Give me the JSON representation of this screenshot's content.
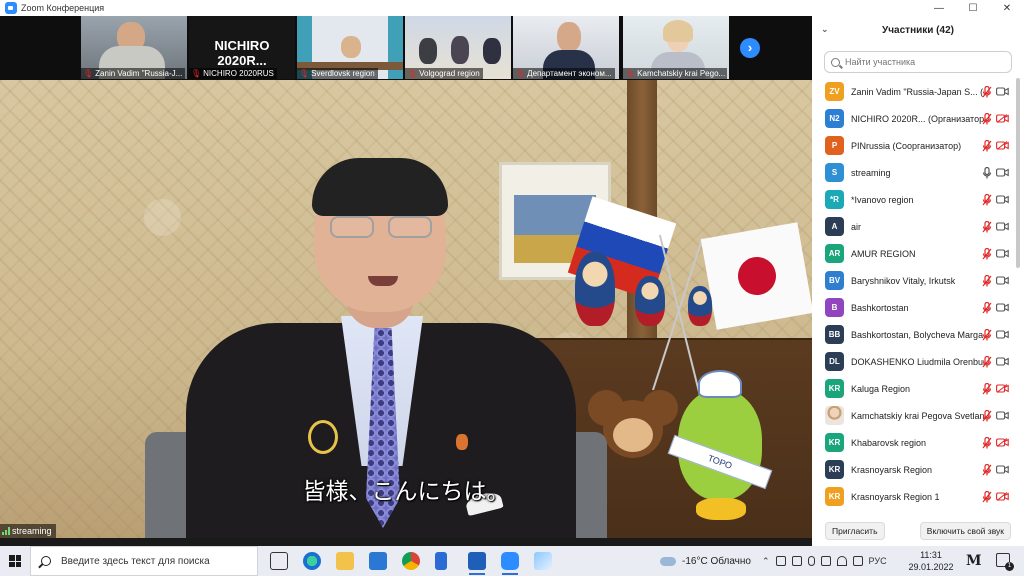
{
  "window": {
    "title": "Zoom Конференция",
    "controls": {
      "minimize": "—",
      "maximize": "☐",
      "close": "✕"
    }
  },
  "thumbnails": [
    {
      "label": "Zanin Vadim \"Russia-J...",
      "muted": true,
      "has_video": true
    },
    {
      "label": "NICHIRO 2020RUS",
      "name_overlay": "NICHIRO 2020R...",
      "muted": true,
      "has_video": false
    },
    {
      "label": "Sverdlovsk region",
      "muted": true,
      "has_video": true
    },
    {
      "label": "Volgograd region",
      "muted": true,
      "has_video": true
    },
    {
      "label": "Департамент эконом...",
      "muted": true,
      "has_video": true
    },
    {
      "label": "Kamchatskiy krai Pego...",
      "muted": true,
      "has_video": true
    }
  ],
  "next_page_icon": "chevron-right-icon",
  "main_video": {
    "speaker": "streaming",
    "subtitle": "皆様、こんにちは。",
    "sash_text": "ТОРО"
  },
  "participants_panel": {
    "title": "Участники (42)",
    "search_placeholder": "Найти участника",
    "participants": [
      {
        "initials": "ZV",
        "color": "#f0a020",
        "name": "Zanin Vadim \"Russia-Japan S... (Я)",
        "mic": "muted",
        "cam": "on"
      },
      {
        "initials": "N2",
        "color": "#2d7fd3",
        "name": "NICHIRO 2020R... (Организатор)",
        "mic": "muted",
        "cam": "off"
      },
      {
        "initials": "P",
        "color": "#e0621e",
        "name": "PINrussia (Соорганизатор)",
        "mic": "muted",
        "cam": "off"
      },
      {
        "initials": "S",
        "color": "#2f8fd3",
        "name": "streaming",
        "mic": "on",
        "cam": "on"
      },
      {
        "initials": "*R",
        "color": "#1aa9b5",
        "name": "*Ivanovo region",
        "mic": "muted",
        "cam": "on"
      },
      {
        "initials": "A",
        "color": "#2c3e55",
        "name": "air",
        "mic": "muted",
        "cam": "on"
      },
      {
        "initials": "AR",
        "color": "#1aa57a",
        "name": "AMUR REGION",
        "mic": "muted",
        "cam": "on"
      },
      {
        "initials": "BV",
        "color": "#2f7fd0",
        "name": "Baryshnikov Vitaly, Irkutsk",
        "mic": "muted",
        "cam": "on"
      },
      {
        "initials": "B",
        "color": "#9146c0",
        "name": "Bashkortostan",
        "mic": "muted",
        "cam": "on"
      },
      {
        "initials": "BB",
        "color": "#2c3e55",
        "name": "Bashkortostan, Bolycheva Marga...",
        "mic": "muted",
        "cam": "on"
      },
      {
        "initials": "DL",
        "color": "#2c3e55",
        "name": "DOKASHENKO Liudmila Orenburg",
        "mic": "muted",
        "cam": "on"
      },
      {
        "initials": "KR",
        "color": "#1aa57a",
        "name": "Kaluga Region",
        "mic": "muted",
        "cam": "off"
      },
      {
        "initials": "",
        "color": "photo",
        "name": "Kamchatskiy krai Pegova Svetlana",
        "mic": "muted",
        "cam": "on"
      },
      {
        "initials": "KR",
        "color": "#1aa57a",
        "name": "Khabarovsk region",
        "mic": "muted",
        "cam": "off"
      },
      {
        "initials": "KR",
        "color": "#2c3e55",
        "name": "Krasnoyarsk Region",
        "mic": "muted",
        "cam": "on"
      },
      {
        "initials": "KR",
        "color": "#f0a020",
        "name": "Krasnoyarsk Region 1",
        "mic": "muted",
        "cam": "off"
      }
    ],
    "footer": {
      "invite": "Пригласить",
      "unmute": "Включить свой звук"
    }
  },
  "taskbar": {
    "search_placeholder": "Введите здесь текст для поиска",
    "weather": "-16°C Облачно",
    "language": "РУС",
    "time": "11:31",
    "date": "29.01.2022",
    "notification_count": "1"
  },
  "colors": {
    "accent": "#2d8cff",
    "muted_red": "#e02828",
    "panel_bg": "#ffffff",
    "video_bg": "#0e0e0e"
  }
}
